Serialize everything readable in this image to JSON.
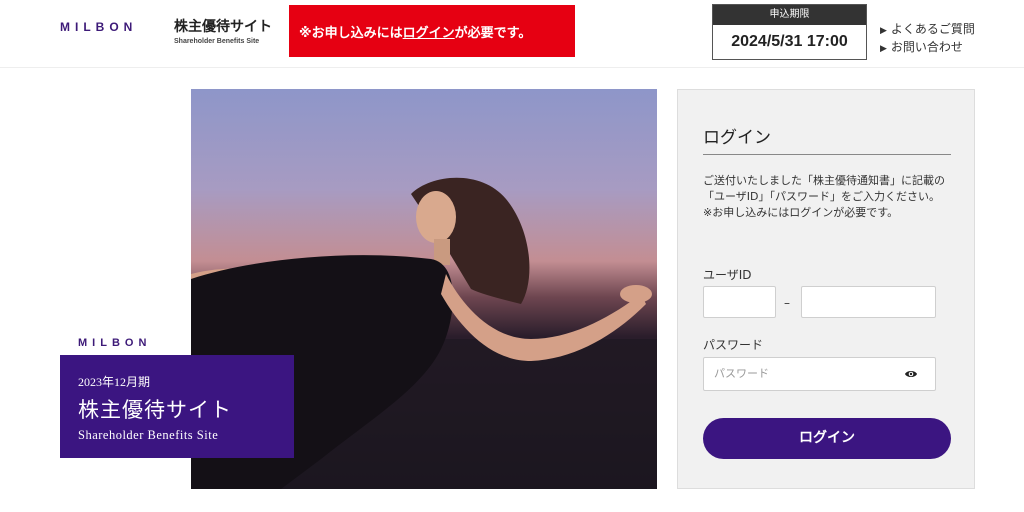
{
  "header": {
    "brand": "MILBON",
    "site_name": "株主優待サイト",
    "site_sub": "Shareholder Benefits Site",
    "notice_prefix": "※お申し込みには",
    "notice_link": "ログイン",
    "notice_suffix": "が必要です。",
    "notice_color": "#e60012",
    "deadline_label": "申込期限",
    "deadline_value": "2024/5/31 17:00",
    "help_links": [
      "よくあるご質問",
      "お問い合わせ"
    ]
  },
  "hero": {
    "brand": "MILBON",
    "term": "2023年12月期",
    "title": "株主優待サイト",
    "subtitle": "Shareholder Benefits Site",
    "accent_color": "#3b1581"
  },
  "login": {
    "title": "ログイン",
    "description": "ご送付いたしました「株主優待通知書」に記載の「ユーザID」「パスワード」をご入力ください。",
    "note": "※お申し込みにはログインが必要です。",
    "user_id_label": "ユーザID",
    "user_id_part1_value": "",
    "user_id_separator": "–",
    "user_id_part2_value": "",
    "password_label": "パスワード",
    "password_placeholder": "パスワード",
    "password_toggle_icon": "eye-icon",
    "submit_label": "ログイン"
  }
}
